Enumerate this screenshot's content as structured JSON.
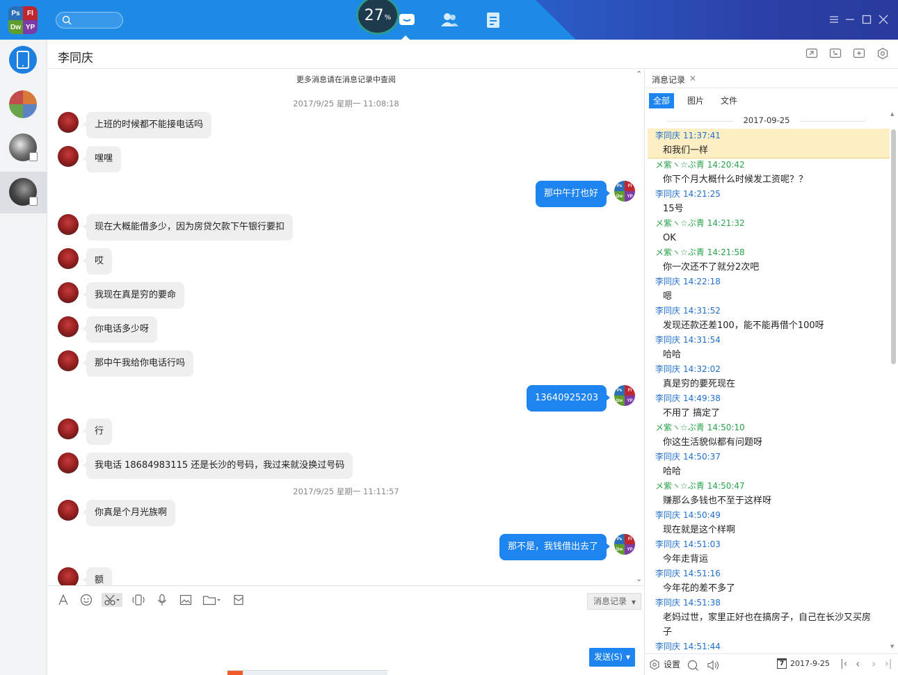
{
  "app": {
    "logo_letters": [
      "Ps",
      "Fl",
      "Dw",
      "YP"
    ],
    "upload_progress_value": "27",
    "upload_progress_unit": "%",
    "colors": {
      "accent": "#1e84f0",
      "topbar": "#1d8ae6",
      "in_bubble": "#efefef",
      "sender_other": "#1f6fd0",
      "sender_self": "#2aa34a",
      "highlight": "#fdeec4"
    }
  },
  "chat": {
    "title": "李同庆",
    "more_hint": "更多消息请在消息记录中查阅",
    "timestamps": [
      "2017/9/25 星期一 11:08:18",
      "2017/9/25 星期一 11:11:57"
    ],
    "messages": [
      {
        "dir": "in",
        "text": "上班的时候都不能接电话吗"
      },
      {
        "dir": "in",
        "text": "嘿嘿"
      },
      {
        "dir": "out",
        "text": "那中午打也好"
      },
      {
        "dir": "in",
        "text": "现在大概能借多少，因为房贷欠款下午银行要扣"
      },
      {
        "dir": "in",
        "text": "哎"
      },
      {
        "dir": "in",
        "text": "我现在真是穷的要命"
      },
      {
        "dir": "in",
        "text": "你电话多少呀"
      },
      {
        "dir": "in",
        "text": "那中午我给你电话行吗"
      },
      {
        "dir": "out",
        "text": "13640925203"
      },
      {
        "dir": "in",
        "text": "行"
      },
      {
        "dir": "in",
        "text": "我电话 18684983115  还是长沙的号码，我过来就没换过号码"
      },
      {
        "dir": "in",
        "text": "你真是个月光族啊"
      },
      {
        "dir": "out",
        "text": "那不是，我钱借出去了"
      },
      {
        "dir": "in",
        "text": "额"
      }
    ]
  },
  "compose": {
    "history_label": "消息记录",
    "send_label": "发送(S)"
  },
  "history": {
    "tab_label": "消息记录",
    "filters": [
      "全部",
      "图片",
      "文件"
    ],
    "date": "2017-09-25",
    "entries": [
      {
        "sender": "李同庆",
        "time": "11:37:41",
        "text": "和我们一样",
        "self": false,
        "highlight": true
      },
      {
        "sender": "メ紫ヽ☆ぷ青",
        "time": "14:20:42",
        "text": "你下个月大概什么时候发工资呢？？",
        "self": true
      },
      {
        "sender": "李同庆",
        "time": "14:21:25",
        "text": "15号",
        "self": false
      },
      {
        "sender": "メ紫ヽ☆ぷ青",
        "time": "14:21:32",
        "text": "OK",
        "self": true
      },
      {
        "sender": "メ紫ヽ☆ぷ青",
        "time": "14:21:58",
        "text": "你一次还不了就分2次吧",
        "self": true
      },
      {
        "sender": "李同庆",
        "time": "14:22:18",
        "text": "嗯",
        "self": false
      },
      {
        "sender": "李同庆",
        "time": "14:31:52",
        "text": "发现还款还差100，能不能再借个100呀",
        "self": false
      },
      {
        "sender": "李同庆",
        "time": "14:31:54",
        "text": "哈哈",
        "self": false
      },
      {
        "sender": "李同庆",
        "time": "14:32:02",
        "text": "真是穷的要死现在",
        "self": false
      },
      {
        "sender": "李同庆",
        "time": "14:49:38",
        "text": "不用了  搞定了",
        "self": false
      },
      {
        "sender": "メ紫ヽ☆ぷ青",
        "time": "14:50:10",
        "text": "你这生活貌似都有问题呀",
        "self": true
      },
      {
        "sender": "李同庆",
        "time": "14:50:37",
        "text": "哈哈",
        "self": false
      },
      {
        "sender": "メ紫ヽ☆ぷ青",
        "time": "14:50:47",
        "text": "赚那么多钱也不至于这样呀",
        "self": true
      },
      {
        "sender": "李同庆",
        "time": "14:50:49",
        "text": "现在就是这个样啊",
        "self": false
      },
      {
        "sender": "李同庆",
        "time": "14:51:03",
        "text": "今年走背运",
        "self": false
      },
      {
        "sender": "李同庆",
        "time": "14:51:16",
        "text": "今年花的差不多了",
        "self": false
      },
      {
        "sender": "李同庆",
        "time": "14:51:38",
        "text": "老妈过世，家里正好也在搞房子，自己在长沙又买房子",
        "self": false
      },
      {
        "sender": "李同庆",
        "time": "14:51:44",
        "text": "",
        "self": false
      }
    ],
    "footer": {
      "settings_label": "设置",
      "calendar_day": "7",
      "date_label": "2017-9-25"
    }
  }
}
